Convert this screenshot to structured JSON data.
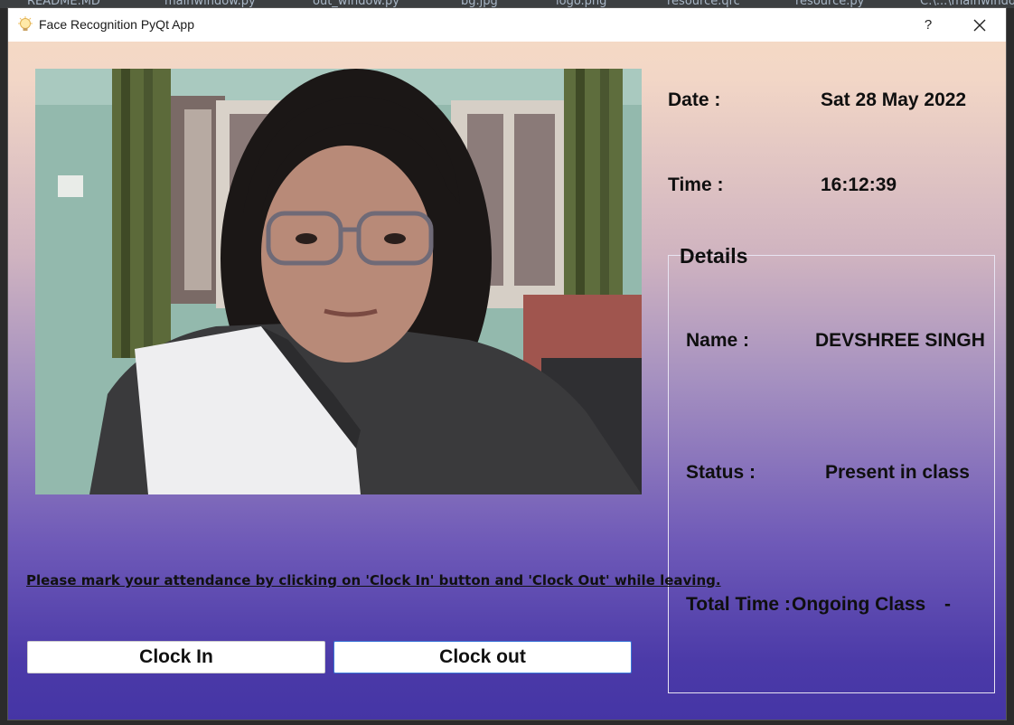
{
  "ide": {
    "tabs": [
      "README.MD",
      "mainwindow.py",
      "out_window.py",
      "bg.jpg",
      "logo.png",
      "resource.qrc",
      "resource.py",
      "C:\\...\\mainwindow"
    ]
  },
  "window": {
    "title": "Face Recognition PyQt App",
    "help_label": "?"
  },
  "info": {
    "date_label": "Date :",
    "date_value": "Sat 28 May 2022",
    "time_label": "Time :",
    "time_value": "16:12:39"
  },
  "details": {
    "title": "Details",
    "name_label": "Name :",
    "name_value": "DEVSHREE SINGH",
    "status_label": "Status :",
    "status_value": "Present in class",
    "total_label": "Total Time :",
    "total_value": "Ongoing Class",
    "total_extra": "-"
  },
  "instructions": "Please mark your attendance by clicking on 'Clock In' button and 'Clock Out' while leaving.",
  "buttons": {
    "clock_in": "Clock In",
    "clock_out": "Clock out"
  },
  "colors": {
    "bg_top": "#f7dcc4",
    "bg_bottom": "#4535a5",
    "focus_border": "#3b78d8"
  }
}
